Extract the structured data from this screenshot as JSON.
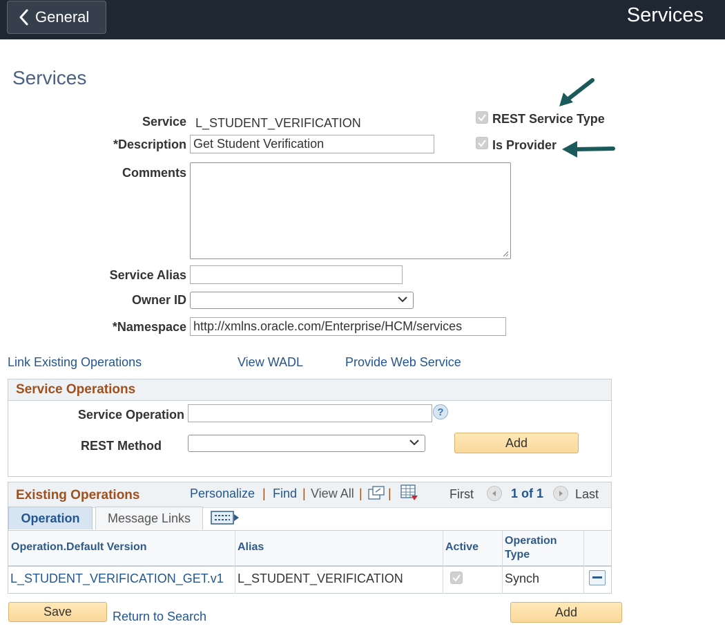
{
  "header": {
    "back_label": "General",
    "title": "Services"
  },
  "page_title": "Services",
  "form": {
    "service_label": "Service",
    "service_value": "L_STUDENT_VERIFICATION",
    "description_label": "*Description",
    "description_value": "Get Student Verification",
    "comments_label": "Comments",
    "comments_value": "",
    "service_alias_label": "Service Alias",
    "service_alias_value": "",
    "owner_id_label": "Owner ID",
    "owner_id_value": "",
    "namespace_label": "*Namespace",
    "namespace_value": "http://xmlns.oracle.com/Enterprise/HCM/services",
    "rest_service_type_label": "REST Service Type",
    "rest_service_type_checked": true,
    "is_provider_label": "Is Provider",
    "is_provider_checked": true
  },
  "links": {
    "link_existing": "Link Existing Operations",
    "view_wadl": "View WADL",
    "provide_web_service": "Provide Web Service"
  },
  "service_operations": {
    "title": "Service Operations",
    "service_operation_label": "Service Operation",
    "service_operation_value": "",
    "rest_method_label": "REST Method",
    "rest_method_value": "",
    "add_label": "Add"
  },
  "existing_operations": {
    "title": "Existing Operations",
    "personalize": "Personalize",
    "find": "Find",
    "view_all": "View All",
    "first": "First",
    "page_info": "1 of 1",
    "last": "Last",
    "tabs": [
      "Operation",
      "Message Links"
    ],
    "columns": [
      "Operation.Default Version",
      "Alias",
      "Active",
      "Operation Type"
    ],
    "rows": [
      {
        "operation": "L_STUDENT_VERIFICATION_GET.v1",
        "alias": "L_STUDENT_VERIFICATION",
        "active": true,
        "type": "Synch"
      }
    ]
  },
  "footer": {
    "save_label": "Save",
    "return_label": "Return to Search",
    "add_label": "Add"
  },
  "colors": {
    "header_bg": "#1f2733",
    "title_blue": "#4a6184",
    "link_blue": "#23568f",
    "group_title": "#a0501e",
    "arrow_teal": "#1b5a5a"
  }
}
